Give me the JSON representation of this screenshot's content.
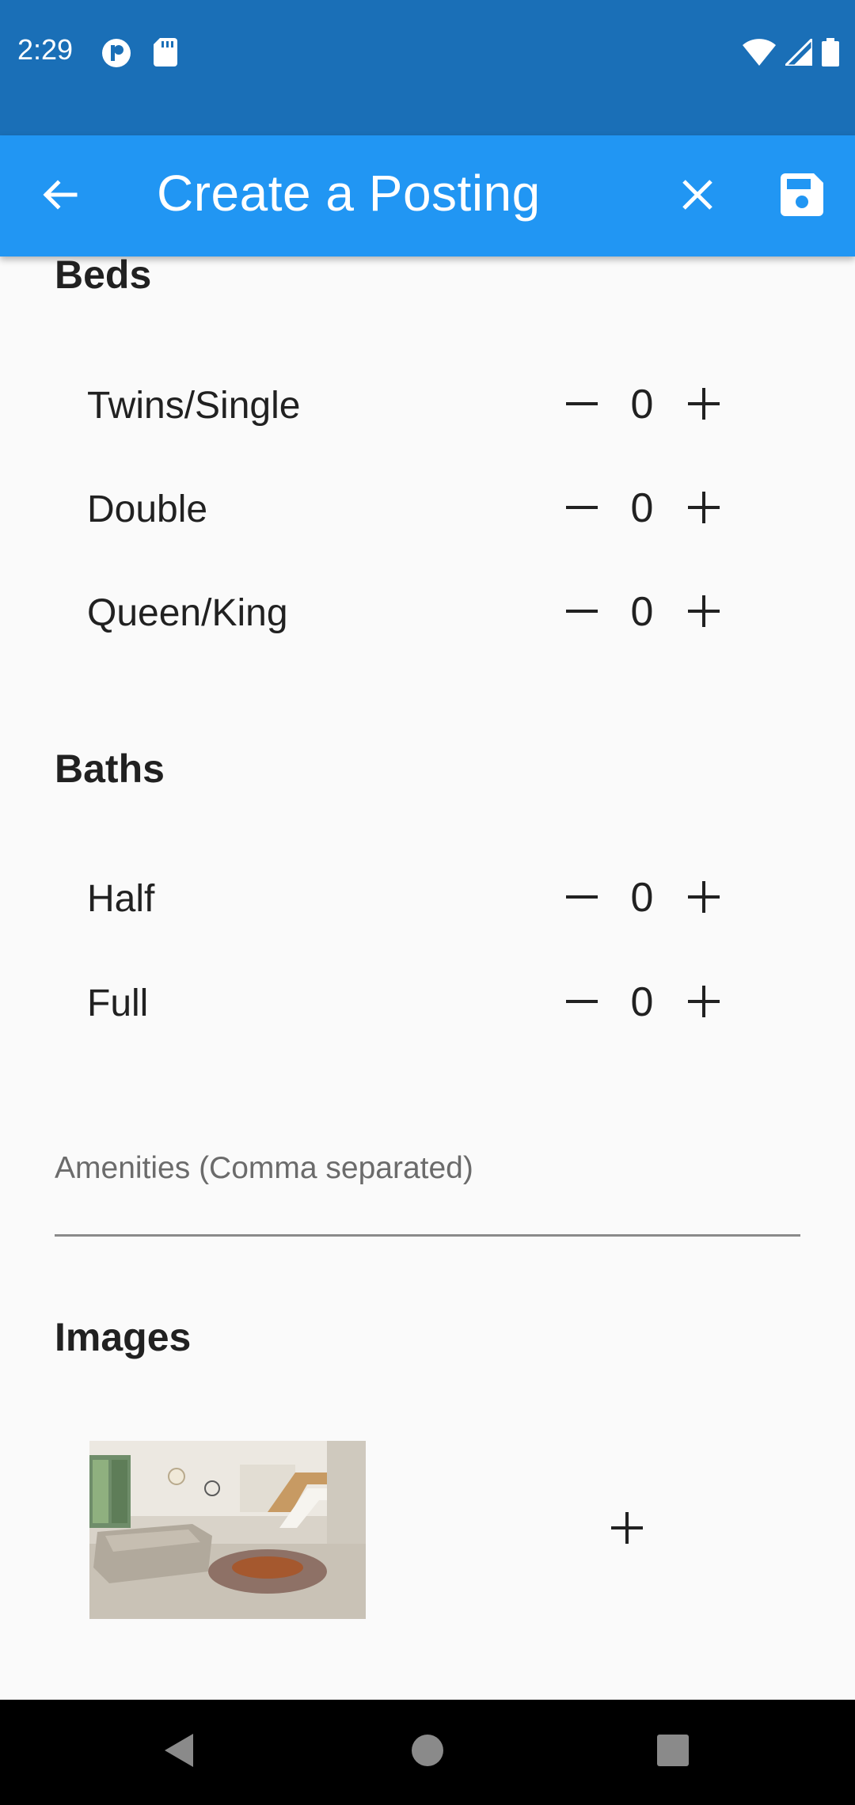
{
  "status_bar": {
    "time": "2:29"
  },
  "app_bar": {
    "title": "Create a Posting",
    "back_icon": "arrow-back-icon",
    "close_icon": "close-icon",
    "save_icon": "save-icon"
  },
  "beds": {
    "heading": "Beds",
    "rows": [
      {
        "label": "Twins/Single",
        "value": "0"
      },
      {
        "label": "Double",
        "value": "0"
      },
      {
        "label": "Queen/King",
        "value": "0"
      }
    ]
  },
  "baths": {
    "heading": "Baths",
    "rows": [
      {
        "label": "Half",
        "value": "0"
      },
      {
        "label": "Full",
        "value": "0"
      }
    ]
  },
  "amenities": {
    "placeholder": "Amenities (Comma separated)",
    "value": ""
  },
  "images": {
    "heading": "Images",
    "add_icon": "plus-icon"
  },
  "colors": {
    "status_bar": "#1a6fb7",
    "app_bar": "#2196f3",
    "background": "#fafafa"
  }
}
